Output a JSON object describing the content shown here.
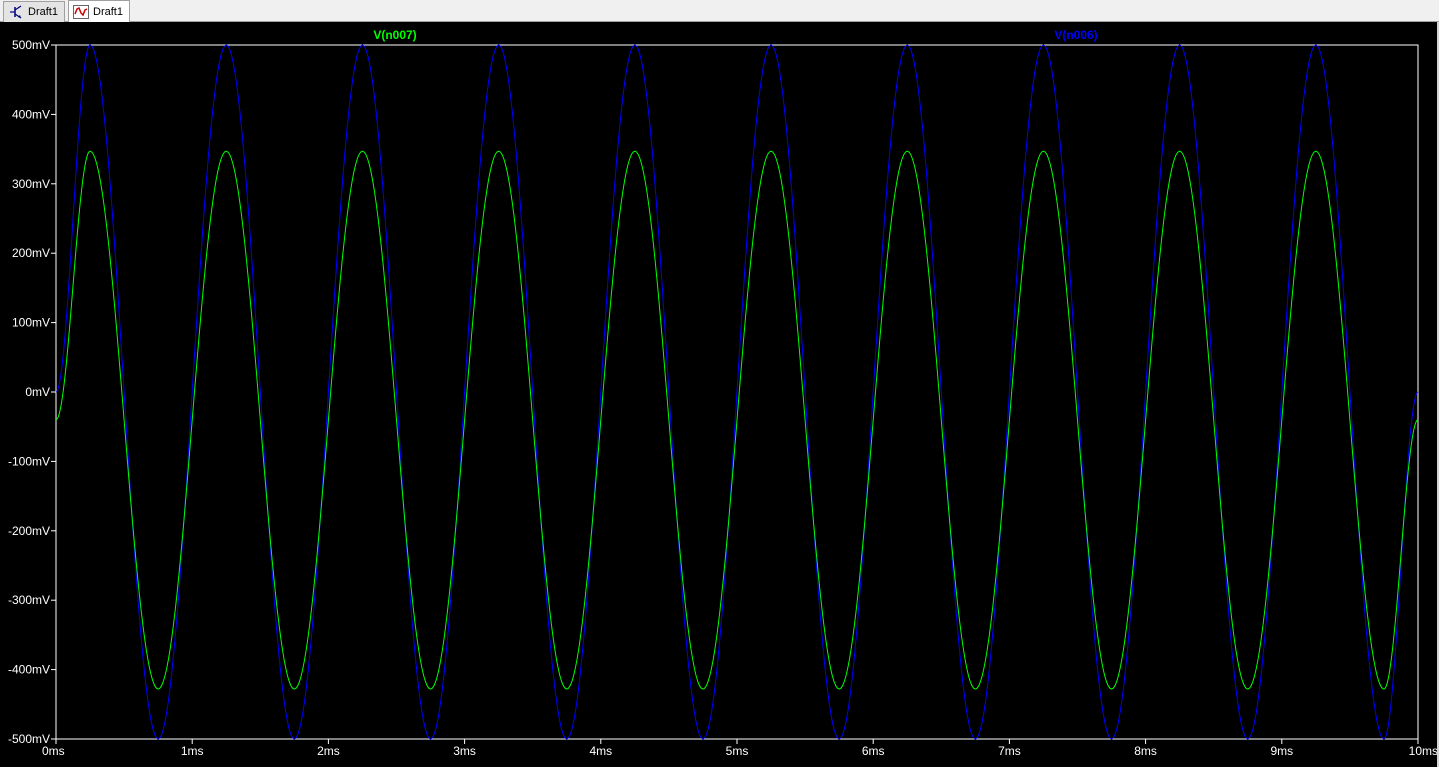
{
  "tabs": [
    {
      "label": "Draft1",
      "icon": "schematic-icon",
      "active": false
    },
    {
      "label": "Draft1",
      "icon": "waveform-icon",
      "active": true
    }
  ],
  "chart_data": {
    "type": "line",
    "xlabel": "",
    "ylabel": "",
    "xlim": [
      0,
      10
    ],
    "ylim": [
      -500,
      500
    ],
    "x_unit": "ms",
    "y_unit": "mV",
    "x_ticks": [
      "0ms",
      "1ms",
      "2ms",
      "3ms",
      "4ms",
      "5ms",
      "6ms",
      "7ms",
      "8ms",
      "9ms",
      "10ms"
    ],
    "y_ticks": [
      "500mV",
      "400mV",
      "300mV",
      "200mV",
      "100mV",
      "0mV",
      "-100mV",
      "-200mV",
      "-300mV",
      "-400mV",
      "-500mV"
    ],
    "grid": false,
    "series": [
      {
        "name": "V(n007)",
        "color": "#00ff00",
        "description_type": "sine",
        "frequency_khz": 1,
        "peaks_mV": [
          347,
          347,
          347,
          347,
          347,
          347,
          347,
          347,
          347,
          347
        ],
        "troughs_mV": [
          -428,
          -428,
          -428,
          -428,
          -428,
          -428,
          -428,
          -428,
          -428,
          -428
        ],
        "peak_times_ms": [
          0.25,
          1.25,
          2.25,
          3.25,
          4.25,
          5.25,
          6.25,
          7.25,
          8.25,
          9.25
        ],
        "trough_times_ms": [
          0.75,
          1.75,
          2.75,
          3.75,
          4.75,
          5.75,
          6.75,
          7.75,
          8.75,
          9.75
        ],
        "start_mV": -40,
        "end_mV": -40
      },
      {
        "name": "V(n006)",
        "color": "#0000ff",
        "description_type": "sine",
        "frequency_khz": 1,
        "peaks_mV": [
          500,
          500,
          500,
          500,
          500,
          500,
          500,
          500,
          500,
          500
        ],
        "troughs_mV": [
          -500,
          -500,
          -500,
          -500,
          -500,
          -500,
          -500,
          -500,
          -500,
          -500
        ],
        "peak_times_ms": [
          0.25,
          1.25,
          2.25,
          3.25,
          4.25,
          5.25,
          6.25,
          7.25,
          8.25,
          9.25
        ],
        "trough_times_ms": [
          0.75,
          1.75,
          2.75,
          3.75,
          4.75,
          5.75,
          6.75,
          7.75,
          8.75,
          9.75
        ],
        "start_mV": 0,
        "end_mV": 0
      }
    ]
  }
}
